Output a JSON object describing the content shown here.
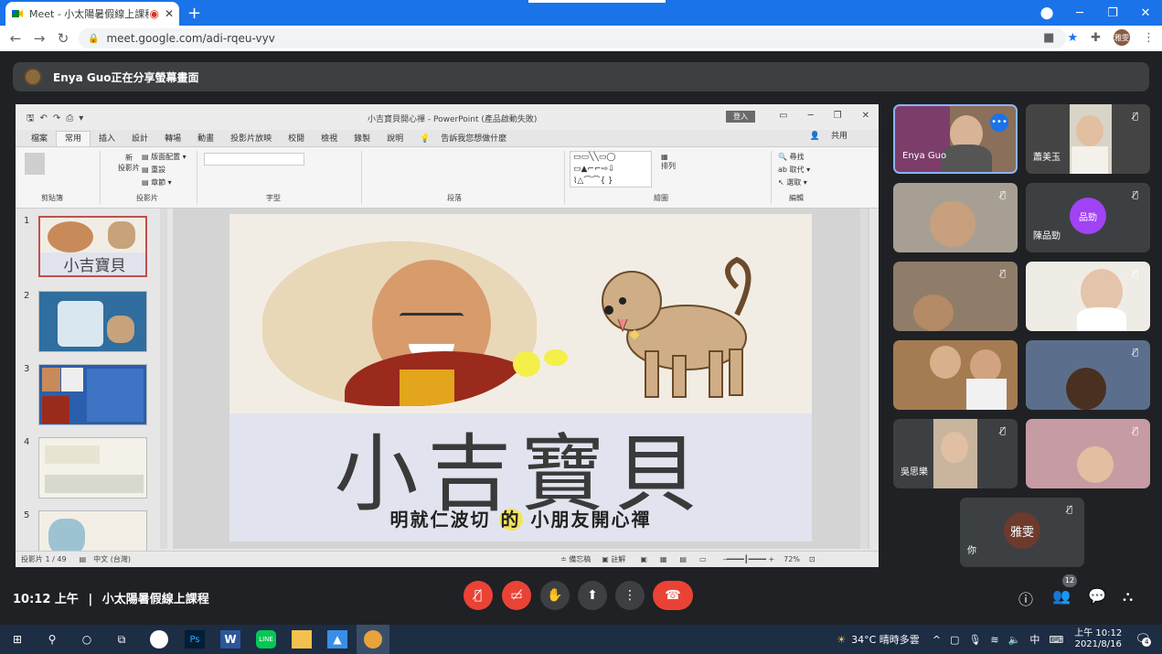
{
  "browser": {
    "tab_title": "Meet - 小太陽暑假線上課程",
    "url": "meet.google.com/adi-rqeu-vyv",
    "profile_initials": "雅雯",
    "window_controls": [
      "─",
      "❐",
      "✕"
    ]
  },
  "meet": {
    "banner_text": "Enya Guo正在分享螢幕畫面",
    "time": "10:12 上午",
    "separator": "|",
    "meeting_title": "小太陽暑假線上課程",
    "participant_count": "12",
    "self_label": "你",
    "self_avatar_text": "雅雯",
    "participants": [
      {
        "name": "Enya Guo",
        "muted": false
      },
      {
        "name": "蕭美玉",
        "muted": true
      },
      {
        "name": "",
        "muted": true
      },
      {
        "name": "陳品勁",
        "muted": true,
        "avatar_text": "品勁"
      },
      {
        "name": "",
        "muted": true
      },
      {
        "name": "",
        "muted": true
      },
      {
        "name": "",
        "muted": false
      },
      {
        "name": "",
        "muted": true
      },
      {
        "name": "吳思樂",
        "muted": true
      },
      {
        "name": "",
        "muted": true
      }
    ]
  },
  "powerpoint": {
    "window_title": "小吉寶貝開心禪 - PowerPoint (產品啟動失敗)",
    "signin": "登入",
    "tabs": [
      "檔案",
      "常用",
      "插入",
      "設計",
      "轉場",
      "動畫",
      "投影片放映",
      "校閱",
      "檢視",
      "錄製",
      "說明"
    ],
    "tell_me": "告訴我您想做什麼",
    "share": "共用",
    "ribbon_groups": [
      "剪貼簿",
      "投影片",
      "字型",
      "段落",
      "繪圖",
      "編輯"
    ],
    "ribbon_items": {
      "new_slide": "新\n投影片",
      "layout": "版面配置",
      "reset": "重設",
      "section": "章節",
      "arrange": "排列",
      "find": "尋找",
      "replace": "取代",
      "select": "選取"
    },
    "slide_numbers": [
      "1",
      "2",
      "3",
      "4",
      "5"
    ],
    "slide": {
      "title": "小吉寶貝",
      "subtitle_before": "明就仁波切",
      "subtitle_mid": "的",
      "subtitle_after": "小朋友開心禪"
    },
    "status": {
      "slide_count": "投影片 1 / 49",
      "language": "中文 (台灣)",
      "notes": "備忘稿",
      "comments": "註解",
      "zoom": "72%"
    }
  },
  "taskbar": {
    "weather": "34°C  晴時多雲",
    "ime": "中",
    "time": "上午 10:12",
    "date": "2021/8/16",
    "notification_count": "4"
  }
}
